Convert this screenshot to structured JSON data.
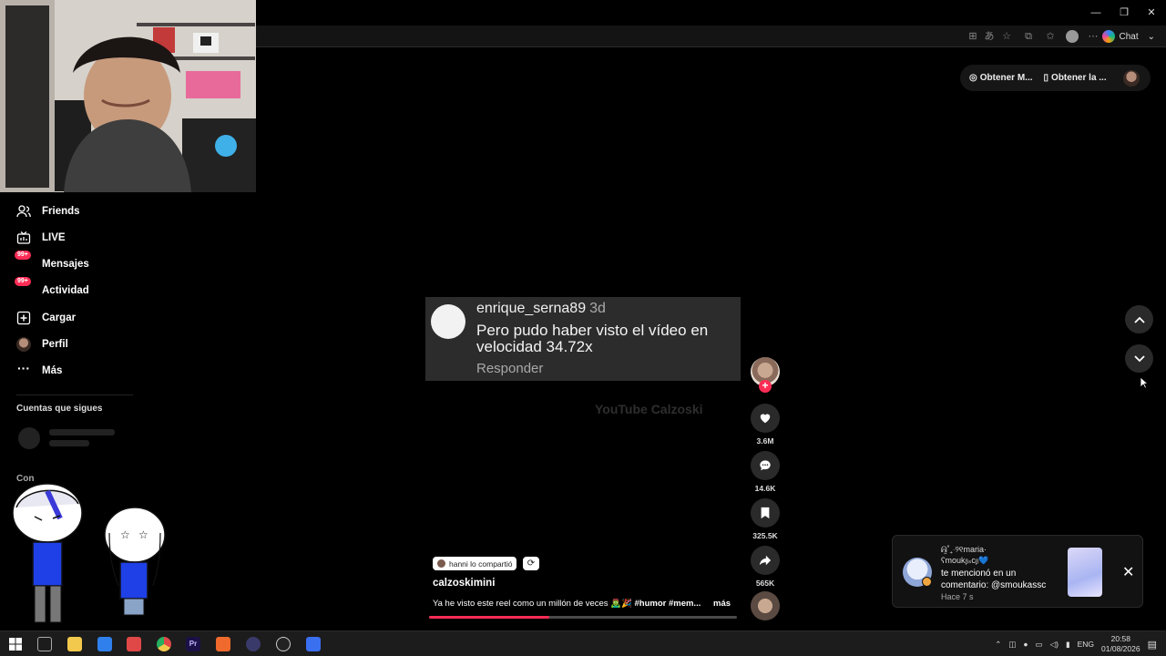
{
  "browser": {
    "chat_label": "Chat",
    "window_controls": {
      "minimize": "—",
      "restore": "❐",
      "close": "✕"
    },
    "toolbar_icons": [
      "app-icon",
      "translate-icon",
      "favorite-icon",
      "extension-icon",
      "favorites-icon",
      "profile-icon",
      "more-icon"
    ]
  },
  "top_bar": {
    "get_app_label": "Obtener M...",
    "get_desktop_label": "Obtener la ..."
  },
  "sidebar": {
    "items": [
      {
        "label": "Friends",
        "icon": "friends-icon"
      },
      {
        "label": "LIVE",
        "icon": "live-icon"
      },
      {
        "label": "Mensajes",
        "icon": "messages-icon",
        "badge": "99+"
      },
      {
        "label": "Actividad",
        "icon": "activity-icon",
        "badge": "99+"
      },
      {
        "label": "Cargar",
        "icon": "upload-icon"
      },
      {
        "label": "Perfil",
        "icon": "profile-avatar"
      },
      {
        "label": "Más",
        "icon": "more-icon"
      }
    ],
    "following_title": "Cuentas que sigues",
    "footer_partial": "Con"
  },
  "video": {
    "comment": {
      "username": "enrique_serna89",
      "age": "3d",
      "text": "Pero pudo haber visto el vídeo en velocidad 34.72x",
      "reply": "Responder"
    },
    "watermark": "YouTube Calzoski",
    "shared_by": "hanni lo compartió",
    "author": "calzoskimini",
    "caption_text": "Ya he visto este reel como un millón de veces 🧟‍♂️🎉 ",
    "caption_tags": "#humor #mem...",
    "more_label": "más",
    "progress": 0.39
  },
  "actions": {
    "likes": "3.6M",
    "comments": "14.6K",
    "saves": "325.5K",
    "shares": "565K"
  },
  "notification": {
    "name": "ᕱ̤̮˚₊‧୨୧maria·\nʕmoukᵦₛcᵦ💙",
    "message": "te mencionó en un comentario: @smoukassc",
    "time": "Hace 7 s"
  },
  "taskbar": {
    "language": "ENG",
    "time": "20:58",
    "date": "01/08/2026",
    "apps": [
      "windows-start",
      "task-view",
      "file-explorer",
      "store",
      "roblox",
      "chrome",
      "premiere",
      "brave",
      "app-arrow",
      "obs",
      "app-blue"
    ]
  },
  "colors": {
    "accent": "#fe2c55",
    "background": "#000000",
    "panel": "#2a2a2a"
  }
}
